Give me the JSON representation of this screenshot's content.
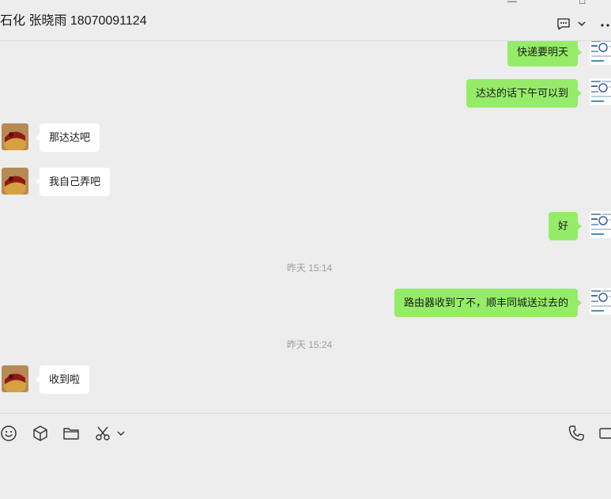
{
  "header": {
    "title": "石化 张晓雨 18070091124",
    "window_min": "—",
    "window_max": "□"
  },
  "messages": [
    {
      "from": "me",
      "text": "快递要明天"
    },
    {
      "from": "me",
      "text": "达达的话下午可以到"
    },
    {
      "from": "other",
      "text": "那达达吧"
    },
    {
      "from": "other",
      "text": "我自己弄吧"
    },
    {
      "from": "me",
      "text": "好"
    },
    {
      "type": "time",
      "text": "昨天 15:14"
    },
    {
      "from": "me",
      "text": "路由器收到了不，顺丰同城送过去的"
    },
    {
      "type": "time",
      "text": "昨天 15:24"
    },
    {
      "from": "other",
      "text": "收到啦"
    }
  ],
  "toolbar": {
    "left": [
      "emoji-icon",
      "package-icon",
      "folder-icon",
      "scissors-icon",
      "chevron-down-icon"
    ],
    "right": [
      "phone-icon",
      "video-icon"
    ]
  },
  "colors": {
    "background": "#ededed",
    "my_bubble": "#95ec69",
    "their_bubble": "#ffffff",
    "timestamp": "#9c9c9c"
  }
}
